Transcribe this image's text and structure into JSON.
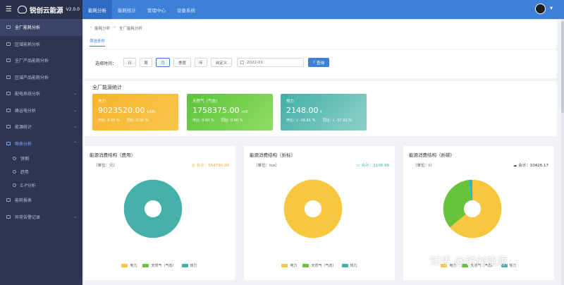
{
  "app": {
    "name": "锐创云能源",
    "version": "V2.0.0"
  },
  "sidebar": {
    "items": [
      {
        "label": "全厂能耗分析"
      },
      {
        "label": "区域能耗分析"
      },
      {
        "label": "全厂产品能耗分析"
      },
      {
        "label": "区域产品能耗分析"
      },
      {
        "label": "配电系统分析"
      },
      {
        "label": "峰谷电分析"
      },
      {
        "label": "能源统计"
      },
      {
        "label": "图表分析"
      },
      {
        "label": "能耗报表"
      },
      {
        "label": "异常告警记录"
      }
    ],
    "subitems": [
      {
        "label": "饼图"
      },
      {
        "label": "趋势"
      },
      {
        "label": "E-P分析"
      }
    ]
  },
  "topnav": {
    "tabs": [
      "能耗分析",
      "能耗统计",
      "管理中心",
      "设备系统"
    ]
  },
  "breadcrumb": {
    "home": "能耗分析",
    "sep": ">",
    "current": "全厂能耗分析"
  },
  "filter": {
    "tab": "筛选条件",
    "label": "选择时间：",
    "periods": [
      "日",
      "周",
      "月",
      "季度",
      "年",
      "自定义"
    ],
    "date": "2022-01",
    "query": "查询"
  },
  "stats": {
    "title": "全厂能源统计",
    "cards": [
      {
        "name": "电力",
        "value": "9023520.00",
        "unit": "kWh",
        "ratio1": "环比: 0.00 %",
        "ratio2": "同比: 0.00 %",
        "color": "#f8b42c"
      },
      {
        "name": "天然气（气态）",
        "value": "1758375.00",
        "unit": "m3",
        "ratio1": "环比: 0.00 %",
        "ratio2": "同比: 0.00 %",
        "color": "#5cc43b"
      },
      {
        "name": "热力",
        "value": "2148.00",
        "unit": "t",
        "ratio1": "环比: ↓ -16.61 %",
        "ratio2": "同比: ↓ -37.01 %",
        "color": "#3fb0a6"
      }
    ]
  },
  "charts": [
    {
      "title": "能源消费结构（费用）",
      "unit": "（单位：元）",
      "total_label": "合计：",
      "total": "554790.00",
      "total_color": "#f5a623"
    },
    {
      "title": "能源消费结构（折标）",
      "unit": "（单位：tce）",
      "total_label": "合计：",
      "total": "1108.99",
      "total_color": "#2db7b0"
    },
    {
      "title": "能源消费结构（折碳）",
      "unit": "（单位：t）",
      "total_label": "合计：",
      "total": "10426.17",
      "total_color": "#333333"
    }
  ],
  "chart_data": [
    {
      "type": "pie",
      "categories": [
        "电力",
        "天然气（气态）",
        "热力"
      ],
      "values": [
        0,
        0,
        100
      ]
    },
    {
      "type": "pie",
      "categories": [
        "电力",
        "天然气（气态）",
        "热力"
      ],
      "values": [
        100,
        0,
        0
      ]
    },
    {
      "type": "pie",
      "categories": [
        "电力",
        "天然气（气态）",
        "热力"
      ],
      "values": [
        64,
        34,
        2
      ]
    }
  ],
  "legend": {
    "items": [
      "电力",
      "天然气（气态）",
      "热力"
    ],
    "colors": [
      "#f7c73f",
      "#68c23a",
      "#45b1a8"
    ]
  },
  "watermark": "知乎 @锐创能源"
}
